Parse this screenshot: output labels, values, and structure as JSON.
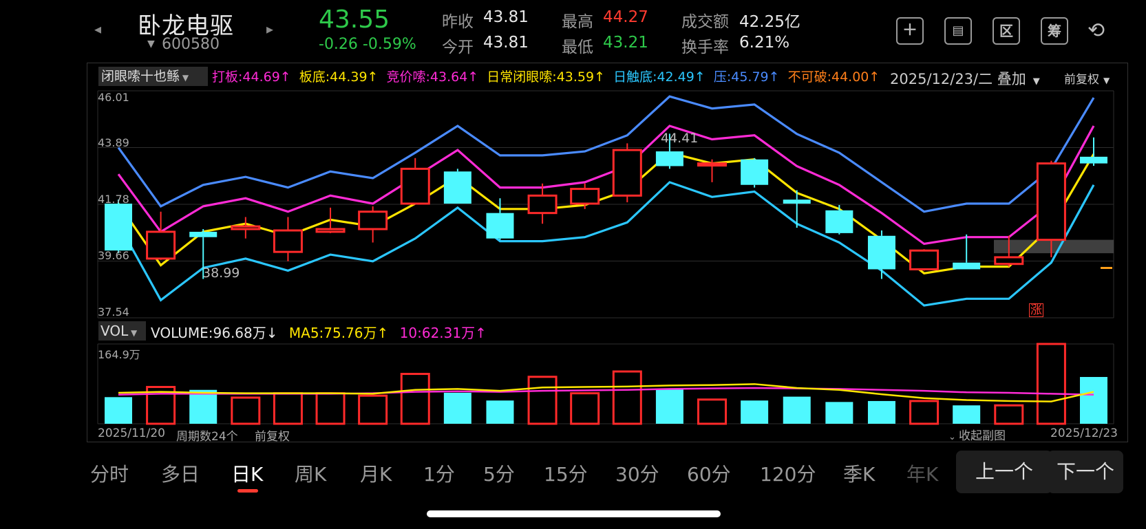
{
  "header": {
    "stock_name": "卧龙电驱",
    "stock_code": "600580",
    "price": "43.55",
    "change": "-0.26  -0.59%",
    "stats": [
      {
        "label": "昨收",
        "value": "43.81",
        "color": "#e8e8e8"
      },
      {
        "label": "今开",
        "value": "43.81",
        "color": "#e8e8e8"
      },
      {
        "label": "最高",
        "value": "44.27",
        "color": "#ff3b30"
      },
      {
        "label": "最低",
        "value": "43.21",
        "color": "#2ec94a"
      },
      {
        "label": "成交额",
        "value": "42.25亿",
        "color": "#e8e8e8"
      },
      {
        "label": "换手率",
        "value": "6.21%",
        "color": "#e8e8e8"
      }
    ],
    "toolbar": [
      {
        "icon": "plus-icon",
        "glyph": "+"
      },
      {
        "icon": "picture-icon",
        "glyph": "画"
      },
      {
        "icon": "region-icon",
        "glyph": "区"
      },
      {
        "icon": "chips-icon",
        "glyph": "筹"
      },
      {
        "icon": "rotate-screen-icon",
        "glyph": "⟲"
      }
    ]
  },
  "indicator": {
    "name": "闭眼嗦十也鲧",
    "items": [
      {
        "text": "打板:44.69↑",
        "color": "#ff2bd6"
      },
      {
        "text": "板底:44.39↑",
        "color": "#ffe500"
      },
      {
        "text": "竞价嗦:43.64↑",
        "color": "#ff2bd6"
      },
      {
        "text": "日常闭眼嗦:43.59↑",
        "color": "#ffe500"
      },
      {
        "text": "日触底:42.49↑",
        "color": "#2bc7ff"
      },
      {
        "text": "压:45.79↑",
        "color": "#4a8bff"
      },
      {
        "text": "不可破:44.00↑",
        "color": "#ff7f1a"
      }
    ],
    "date_mode": "2025/12/23/二 叠加",
    "adjust": "前复权"
  },
  "chart_data": {
    "type": "candlestick",
    "y_ticks": [
      "46.01",
      "43.89",
      "41.78",
      "39.66",
      "37.54"
    ],
    "ylim": [
      37.54,
      46.01
    ],
    "candles": [
      {
        "o": 41.8,
        "c": 40.05,
        "h": 41.95,
        "l": 39.95
      },
      {
        "o": 39.75,
        "c": 40.75,
        "h": 41.5,
        "l": 39.7
      },
      {
        "o": 40.75,
        "c": 40.55,
        "h": 40.85,
        "l": 38.99
      },
      {
        "o": 40.85,
        "c": 40.95,
        "h": 41.3,
        "l": 40.5
      },
      {
        "o": 40.0,
        "c": 40.8,
        "h": 41.3,
        "l": 39.65
      },
      {
        "o": 40.75,
        "c": 40.85,
        "h": 41.65,
        "l": 40.7
      },
      {
        "o": 40.85,
        "c": 41.5,
        "h": 41.7,
        "l": 40.35
      },
      {
        "o": 41.8,
        "c": 43.1,
        "h": 43.5,
        "l": 41.8
      },
      {
        "o": 43.0,
        "c": 41.8,
        "h": 43.1,
        "l": 41.8
      },
      {
        "o": 41.45,
        "c": 40.5,
        "h": 42.0,
        "l": 40.45
      },
      {
        "o": 41.45,
        "c": 42.1,
        "h": 42.55,
        "l": 41.05
      },
      {
        "o": 41.8,
        "c": 42.35,
        "h": 42.55,
        "l": 41.6
      },
      {
        "o": 42.1,
        "c": 43.8,
        "h": 44.05,
        "l": 41.85
      },
      {
        "o": 43.75,
        "c": 43.2,
        "h": 44.41,
        "l": 43.1
      },
      {
        "o": 43.3,
        "c": 43.3,
        "h": 43.45,
        "l": 42.6
      },
      {
        "o": 43.45,
        "c": 42.5,
        "h": 43.5,
        "l": 42.4
      },
      {
        "o": 41.95,
        "c": 41.8,
        "h": 42.3,
        "l": 40.9
      },
      {
        "o": 41.55,
        "c": 40.7,
        "h": 41.75,
        "l": 40.65
      },
      {
        "o": 40.6,
        "c": 39.35,
        "h": 40.8,
        "l": 38.99
      },
      {
        "o": 39.35,
        "c": 40.05,
        "h": 40.1,
        "l": 39.3
      },
      {
        "o": 39.6,
        "c": 39.35,
        "h": 40.65,
        "l": 39.35
      },
      {
        "o": 39.55,
        "c": 39.8,
        "h": 40.6,
        "l": 39.45
      },
      {
        "o": 40.45,
        "c": 43.3,
        "h": 43.4,
        "l": 39.8
      },
      {
        "o": 43.55,
        "c": 43.3,
        "h": 44.27,
        "l": 43.21
      }
    ],
    "lines": [
      {
        "name": "压",
        "color": "#4a8bff",
        "values": [
          43.89,
          41.7,
          42.5,
          42.8,
          42.4,
          43.0,
          42.75,
          43.7,
          44.7,
          43.6,
          43.6,
          43.75,
          44.35,
          45.8,
          45.35,
          45.5,
          44.4,
          43.7,
          42.6,
          41.5,
          41.8,
          41.8,
          43.1,
          45.75
        ]
      },
      {
        "name": "打板",
        "color": "#ff2bd6",
        "values": [
          42.9,
          40.75,
          41.7,
          42.0,
          41.5,
          42.1,
          41.8,
          42.8,
          43.8,
          42.4,
          42.4,
          42.6,
          43.2,
          44.7,
          44.2,
          44.35,
          43.2,
          42.5,
          41.45,
          40.3,
          40.55,
          40.55,
          41.8,
          44.7
        ]
      },
      {
        "name": "板底",
        "color": "#ffe500",
        "values": [
          41.8,
          39.5,
          40.75,
          41.05,
          40.6,
          41.2,
          40.95,
          41.8,
          42.8,
          41.6,
          41.6,
          41.75,
          42.3,
          43.7,
          43.3,
          43.45,
          42.2,
          41.6,
          40.45,
          39.2,
          39.45,
          39.45,
          40.95,
          43.65
        ]
      },
      {
        "name": "日触底",
        "color": "#2bc7ff",
        "values": [
          41.05,
          38.2,
          39.4,
          39.75,
          39.3,
          39.9,
          39.65,
          40.5,
          41.65,
          40.4,
          40.4,
          40.55,
          41.1,
          42.6,
          42.05,
          42.25,
          41.05,
          40.35,
          39.3,
          38.0,
          38.25,
          38.25,
          39.6,
          42.5
        ]
      }
    ],
    "low_label": "38.99",
    "high_label": "44.41",
    "marker_label": "涨",
    "volume": {
      "name": "VOL",
      "legend": [
        {
          "text": "VOLUME:96.68万↓",
          "color": "#e8e8e8"
        },
        {
          "text": "MA5:75.76万↑",
          "color": "#ffe500"
        },
        {
          "text": "10:62.31万↑",
          "color": "#ff2bd6"
        }
      ],
      "max_label": "164.9万",
      "ylim": [
        0,
        164.9
      ],
      "values": [
        55,
        76,
        70,
        54,
        63,
        63,
        58,
        103,
        64,
        48,
        97,
        63,
        108,
        72,
        50,
        48,
        56,
        45,
        47,
        47,
        38,
        38,
        164.9,
        96.68
      ],
      "ma5": [
        64,
        66,
        64,
        63,
        63,
        63,
        62,
        70,
        72,
        68,
        75,
        76,
        77,
        79,
        80,
        82,
        74,
        70,
        61,
        53,
        49,
        47,
        46,
        66,
        76
      ],
      "ma10": [
        60,
        62,
        62,
        62,
        62,
        62,
        63,
        66,
        67,
        66,
        68,
        69,
        70,
        72,
        73,
        74,
        73,
        72,
        70,
        68,
        65,
        64,
        62,
        60,
        62
      ]
    },
    "start_date": "2025/11/20",
    "end_date": "2025/12/23",
    "period_count": "周期数24个",
    "adjust_bottom": "前复权",
    "collapse_label": "收起副图"
  },
  "tabs": [
    "分时",
    "多日",
    "日K",
    "周K",
    "月K",
    "1分",
    "5分",
    "15分",
    "30分",
    "60分",
    "120分",
    "季K",
    "年K"
  ],
  "active_tab": 2,
  "prev_button": "上一个",
  "next_button": "下一个"
}
